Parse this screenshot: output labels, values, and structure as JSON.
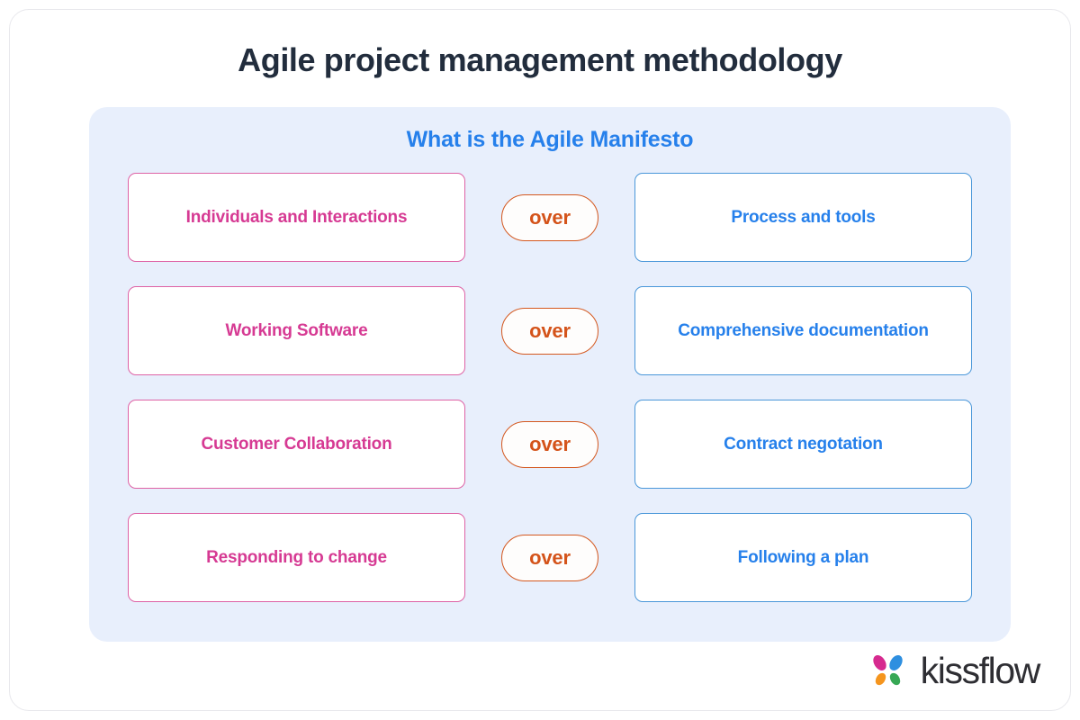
{
  "headline": "Agile project management methodology",
  "panel": {
    "title": "What is the Agile Manifesto",
    "connector_label": "over",
    "rows": [
      {
        "left": "Individuals and Interactions",
        "connector": "over",
        "right": "Process and tools"
      },
      {
        "left": "Working Software",
        "connector": "over",
        "right": "Comprehensive documentation"
      },
      {
        "left": "Customer Collaboration",
        "connector": "over",
        "right": "Contract negotation"
      },
      {
        "left": "Responding to change",
        "connector": "over",
        "right": "Following a plan"
      }
    ]
  },
  "brand": {
    "name": "kissflow",
    "mark_colors": {
      "top_left": "#d62a8f",
      "top_right": "#2e8fe0",
      "bottom_left": "#f5951e",
      "bottom_right": "#37a855"
    }
  },
  "colors": {
    "headline": "#222d3d",
    "panel_background": "#e8effc",
    "panel_title": "#2680eb",
    "left_card_border": "#de62a5",
    "left_card_text": "#d63a93",
    "right_card_border": "#4a97d9",
    "right_card_text": "#2680eb",
    "connector_border": "#d4581f",
    "connector_text": "#d4531a",
    "card_background": "#ffffff",
    "page_background": "#ffffff",
    "brand_text": "#2e2e33"
  }
}
